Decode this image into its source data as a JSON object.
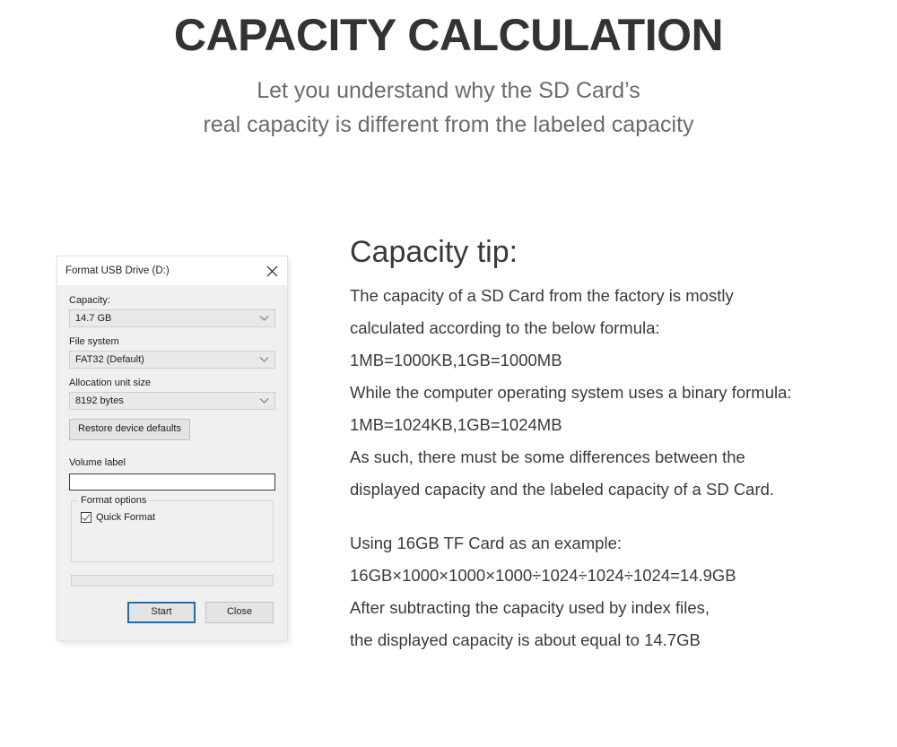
{
  "header": {
    "title": "CAPACITY CALCULATION",
    "subtitle_lines": [
      "Let you understand why the SD Card’s",
      "real capacity is different from the labeled capacity"
    ]
  },
  "dialog": {
    "title": "Format USB Drive (D:)",
    "close_icon": "close-icon",
    "fields": {
      "capacity": {
        "label": "Capacity:",
        "value": "14.7 GB",
        "chevron_icon": "chevron-down-icon"
      },
      "file_system": {
        "label": "File system",
        "value": "FAT32 (Default)",
        "chevron_icon": "chevron-down-icon"
      },
      "allocation_unit_size": {
        "label": "Allocation unit size",
        "value": "8192 bytes",
        "chevron_icon": "chevron-down-icon"
      },
      "volume_label": {
        "label": "Volume label",
        "value": "",
        "placeholder": ""
      }
    },
    "restore_button": "Restore device defaults",
    "format_options": {
      "title": "Format options",
      "quick_format": {
        "label": "Quick Format",
        "checked": true,
        "check_icon": "checkmark-icon"
      }
    },
    "buttons": {
      "start": "Start",
      "close": "Close"
    },
    "focus_color": "#1e6fa8"
  },
  "tip": {
    "heading": "Capacity tip:",
    "paragraph_one": [
      "The capacity of a SD Card from the factory is mostly",
      "calculated according to the below formula:",
      "1MB=1000KB,1GB=1000MB",
      "While the computer operating system uses a binary formula:",
      "1MB=1024KB,1GB=1024MB",
      "As such, there must be some differences between the",
      "displayed capacity and the labeled capacity of a SD Card."
    ],
    "paragraph_two": [
      "Using 16GB TF Card as an example:",
      "16GB×1000×1000×1000÷1024÷1024÷1024=14.9GB",
      "After subtracting the capacity used by index files,",
      "the displayed capacity is about equal to 14.7GB"
    ]
  }
}
